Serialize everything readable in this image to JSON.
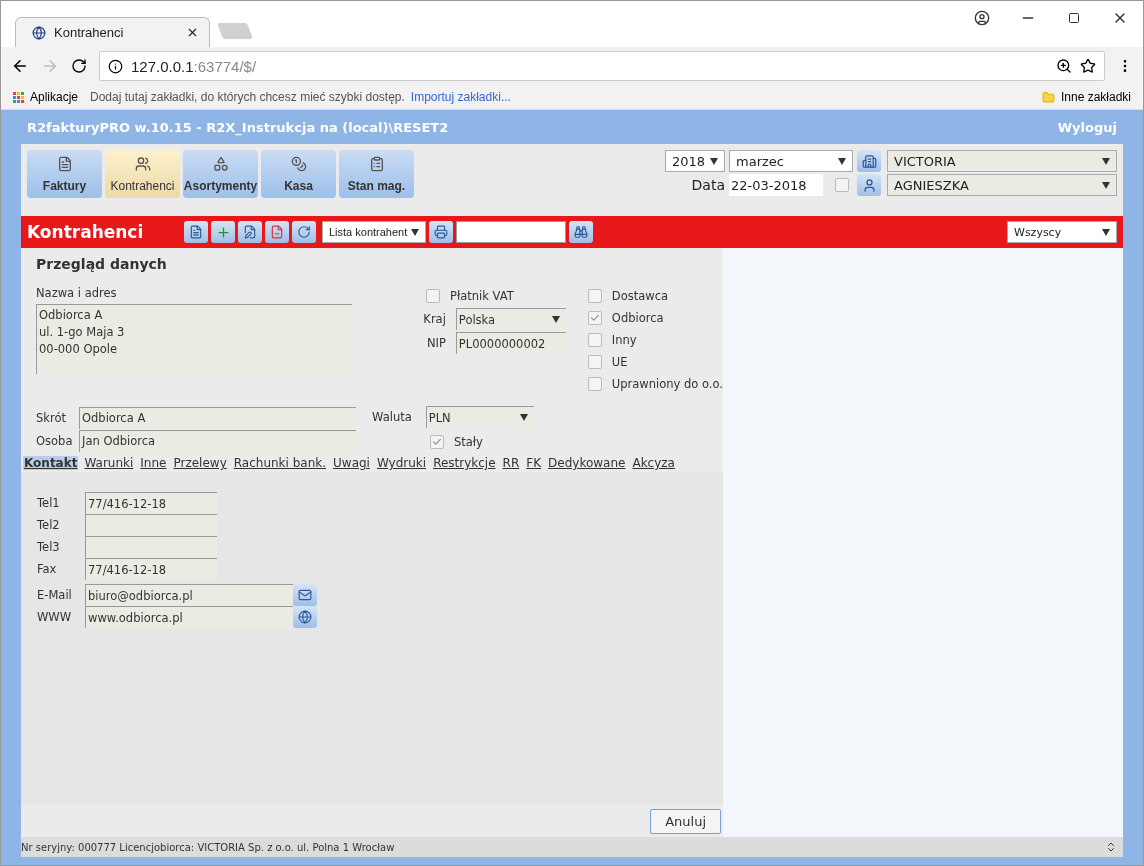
{
  "browser": {
    "tab_title": "Kontrahenci",
    "address_host": "127.0.0.1",
    "address_rest": ":63774/$/",
    "apps_label": "Aplikacje",
    "bookmarks_hint": "Dodaj tutaj zakładki, do których chcesz mieć szybki dostęp.",
    "import_link": "Importuj zakładki...",
    "other_bookmarks": "Inne zakładki"
  },
  "app": {
    "title": "R2fakturyPRO w.10.15 - R2X_Instrukcja na (local)\\RESET2",
    "logout": "Wyloguj"
  },
  "modules": [
    {
      "label": "Faktury",
      "selected": false
    },
    {
      "label": "Kontrahenci",
      "selected": true
    },
    {
      "label": "Asortymenty",
      "selected": false
    },
    {
      "label": "Kasa",
      "selected": false
    },
    {
      "label": "Stan mag.",
      "selected": false
    }
  ],
  "period": {
    "year": "2018",
    "month": "marzec",
    "date_label": "Data",
    "date": "22-03-2018",
    "date_checked": false,
    "company": "VICTORIA",
    "user": "AGNIESZKA"
  },
  "section": {
    "title": "Kontrahenci",
    "view": "Lista kontrahent",
    "filter": "Wszyscy"
  },
  "form": {
    "heading": "Przegląd danych",
    "name_label": "Nazwa i adres",
    "address_lines": [
      "Odbiorca A",
      "ul. 1-go Maja 3",
      "00-000 Opole"
    ],
    "vat_payer": {
      "label": "Płatnik VAT",
      "checked": false
    },
    "country_label": "Kraj",
    "country": "Polska",
    "nip_label": "NIP",
    "nip": "PL0000000002",
    "roles": [
      {
        "label": "Dostawca",
        "checked": false
      },
      {
        "label": "Odbiorca",
        "checked": true
      },
      {
        "label": "Inny",
        "checked": false
      },
      {
        "label": "UE",
        "checked": false
      },
      {
        "label": "Uprawniony do o.o.",
        "checked": false
      }
    ],
    "short_label": "Skrót",
    "short": "Odbiorca A",
    "person_label": "Osoba",
    "person": "Jan Odbiorca",
    "currency_label": "Waluta",
    "currency": "PLN",
    "permanent": {
      "label": "Stały",
      "checked": true
    }
  },
  "tabs": [
    {
      "label": "Kontakt",
      "selected": true
    },
    {
      "label": "Warunki",
      "selected": false
    },
    {
      "label": "Inne",
      "selected": false
    },
    {
      "label": "Przelewy",
      "selected": false
    },
    {
      "label": "Rachunki bank.",
      "selected": false
    },
    {
      "label": "Uwagi",
      "selected": false
    },
    {
      "label": "Wydruki",
      "selected": false
    },
    {
      "label": "Restrykcje",
      "selected": false
    },
    {
      "label": "RR",
      "selected": false
    },
    {
      "label": "FK",
      "selected": false
    },
    {
      "label": "Dedykowane",
      "selected": false
    },
    {
      "label": "Akcyza",
      "selected": false
    }
  ],
  "contact": [
    {
      "kind": "phone",
      "label": "Tel1",
      "value": "77/416-12-18"
    },
    {
      "kind": "phone",
      "label": "Tel2"
    },
    {
      "kind": "phone",
      "label": "Tel3"
    },
    {
      "kind": "phone",
      "label": "Fax",
      "value": "77/416-12-18"
    },
    {
      "kind": "email",
      "label": "E-Mail",
      "value": "biuro@odbiorca.pl"
    },
    {
      "kind": "web",
      "label": "WWW",
      "value": "www.odbiorca.pl"
    }
  ],
  "buttons": [
    "Anuluj"
  ],
  "status_bar": "Nr seryjny: 000777 Licencjobiorca: VICTORIA Sp. z o.o. ul. Polna 1 Wrocław"
}
